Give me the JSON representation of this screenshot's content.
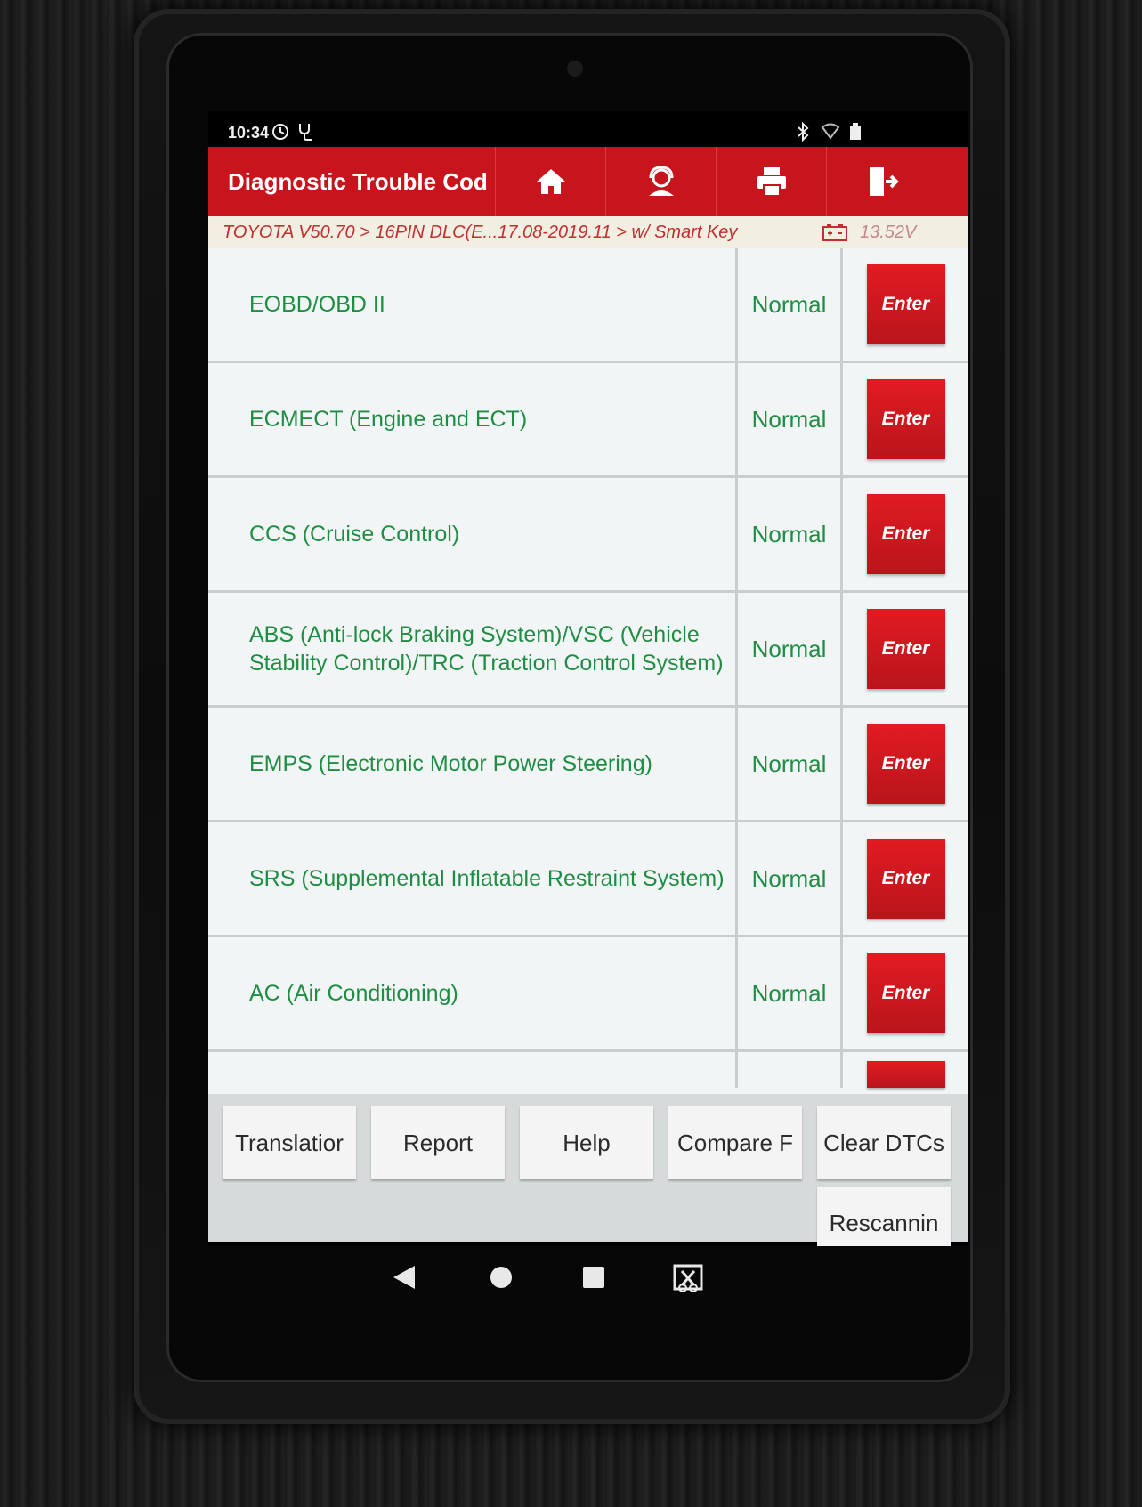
{
  "status_bar": {
    "time": "10:34"
  },
  "app_bar": {
    "title": "Diagnostic Trouble Cod",
    "icons": [
      "home-icon",
      "support-agent-icon",
      "print-icon",
      "exit-icon"
    ]
  },
  "breadcrumb": {
    "path": "TOYOTA V50.70 > 16PIN DLC(E...17.08-2019.11 > w/ Smart Key",
    "voltage": "13.52V"
  },
  "systems": [
    {
      "name": "EOBD/OBD II",
      "status": "Normal",
      "action": "Enter"
    },
    {
      "name": "ECMECT (Engine and ECT)",
      "status": "Normal",
      "action": "Enter"
    },
    {
      "name": "CCS (Cruise Control)",
      "status": "Normal",
      "action": "Enter"
    },
    {
      "name": "ABS (Anti-lock Braking System)/VSC (Vehicle Stability Control)/TRC (Traction Control System)",
      "status": "Normal",
      "action": "Enter"
    },
    {
      "name": "EMPS (Electronic Motor Power Steering)",
      "status": "Normal",
      "action": "Enter"
    },
    {
      "name": "SRS (Supplemental Inflatable Restraint System)",
      "status": "Normal",
      "action": "Enter"
    },
    {
      "name": "AC (Air Conditioning)",
      "status": "Normal",
      "action": "Enter"
    }
  ],
  "bottom_buttons": {
    "translation": "Translatior",
    "report": "Report",
    "help": "Help",
    "compare": "Compare F",
    "clear_dtcs": "Clear DTCs",
    "rescanning": "Rescannin"
  },
  "colors": {
    "brand_red": "#c8141c",
    "status_green": "#1f8d43",
    "breadcrumb_text": "#c22f2f"
  }
}
